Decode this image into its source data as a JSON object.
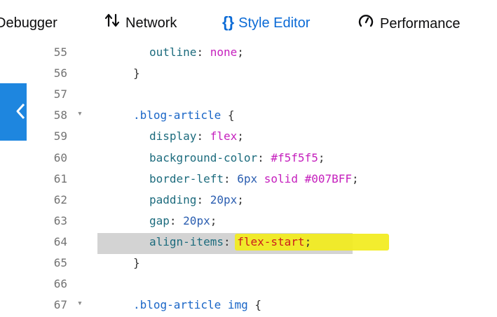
{
  "toolbar": {
    "tabs": [
      {
        "label": "Debugger",
        "icon": "debugger-icon"
      },
      {
        "label": "Network",
        "icon": "network-arrows-icon"
      },
      {
        "label": "Style Editor",
        "icon": "braces-icon",
        "active": true
      },
      {
        "label": "Performance",
        "icon": "gauge-icon"
      }
    ]
  },
  "colors": {
    "active_tab": "#0a6ad6",
    "sidebar_toggle": "#1e86df",
    "highlight": "#f2ec1c",
    "line_highlight": "#d3d3d3"
  },
  "lines": [
    {
      "n": "55",
      "tokens": [
        [
          "prop",
          "outline"
        ],
        [
          "punc",
          ": "
        ],
        [
          "kw",
          "none"
        ],
        [
          "punc",
          ";"
        ]
      ],
      "indent": 2
    },
    {
      "n": "56",
      "tokens": [
        [
          "punc",
          "}"
        ]
      ],
      "indent": 1
    },
    {
      "n": "57",
      "tokens": [],
      "indent": 1
    },
    {
      "n": "58",
      "fold": true,
      "tokens": [
        [
          "sel",
          ".blog-article"
        ],
        [
          "punc",
          " {"
        ]
      ],
      "indent": 1
    },
    {
      "n": "59",
      "tokens": [
        [
          "prop",
          "display"
        ],
        [
          "punc",
          ": "
        ],
        [
          "kw",
          "flex"
        ],
        [
          "punc",
          ";"
        ]
      ],
      "indent": 2
    },
    {
      "n": "60",
      "tokens": [
        [
          "prop",
          "background-color"
        ],
        [
          "punc",
          ": "
        ],
        [
          "hex",
          "#f5f5f5"
        ],
        [
          "punc",
          ";"
        ]
      ],
      "indent": 2
    },
    {
      "n": "61",
      "tokens": [
        [
          "prop",
          "border-left"
        ],
        [
          "punc",
          ": "
        ],
        [
          "num",
          "6px"
        ],
        [
          "punc",
          " "
        ],
        [
          "kw",
          "solid"
        ],
        [
          "punc",
          " "
        ],
        [
          "hex",
          "#007BFF"
        ],
        [
          "punc",
          ";"
        ]
      ],
      "indent": 2
    },
    {
      "n": "62",
      "tokens": [
        [
          "prop",
          "padding"
        ],
        [
          "punc",
          ": "
        ],
        [
          "num",
          "20px"
        ],
        [
          "punc",
          ";"
        ]
      ],
      "indent": 2
    },
    {
      "n": "63",
      "tokens": [
        [
          "prop",
          "gap"
        ],
        [
          "punc",
          ": "
        ],
        [
          "num",
          "20px"
        ],
        [
          "punc",
          ";"
        ]
      ],
      "indent": 2
    },
    {
      "n": "64",
      "highlight": true,
      "tokens": [
        [
          "prop",
          "align-items"
        ],
        [
          "punc",
          ": "
        ],
        [
          "val-red",
          "flex-start"
        ],
        [
          "punc",
          ";"
        ]
      ],
      "indent": 2
    },
    {
      "n": "65",
      "tokens": [
        [
          "punc",
          "}"
        ]
      ],
      "indent": 1
    },
    {
      "n": "66",
      "tokens": [],
      "indent": 1
    },
    {
      "n": "67",
      "fold": true,
      "tokens": [
        [
          "sel",
          ".blog-article img"
        ],
        [
          "punc",
          " {"
        ]
      ],
      "indent": 1
    }
  ]
}
